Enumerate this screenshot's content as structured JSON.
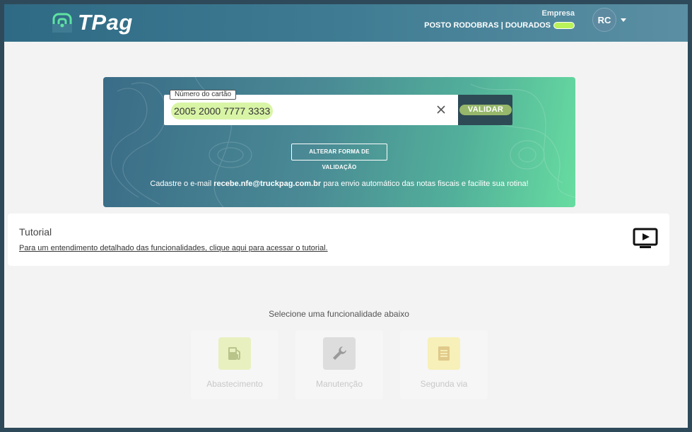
{
  "header": {
    "logo_text": "TPag",
    "company_label": "Empresa",
    "company_name": "POSTO RODOBRAS | DOURADOS",
    "avatar_initials": "RC"
  },
  "validation": {
    "card_label": "Número do cartão",
    "card_value": "2005 2000 7777 3333",
    "validate_label": "VALIDAR",
    "alt_label": "ALTERAR FORMA DE VALIDAÇÃO",
    "message_pre": "Cadastre o e-mail ",
    "message_email": "recebe.nfe@truckpag.com.br",
    "message_post": " para envio automático das notas fiscais e facilite sua rotina!"
  },
  "tutorial": {
    "title": "Tutorial",
    "link_text": "Para um entendimento detalhado das funcionalidades, clique aqui para acessar o tutorial."
  },
  "functions": {
    "prompt": "Selecione uma funcionalidade abaixo",
    "items": [
      {
        "label": "Abastecimento",
        "icon": "fuel-pump-icon",
        "color": "#e8f0c0"
      },
      {
        "label": "Manutenção",
        "icon": "wrench-icon",
        "color": "#dddddd"
      },
      {
        "label": "Segunda via",
        "icon": "document-icon",
        "color": "#f7f0b8"
      }
    ]
  },
  "colors": {
    "accent_green": "#67dca0",
    "highlight": "#b9f35a",
    "header_blue": "#2f6a84"
  }
}
